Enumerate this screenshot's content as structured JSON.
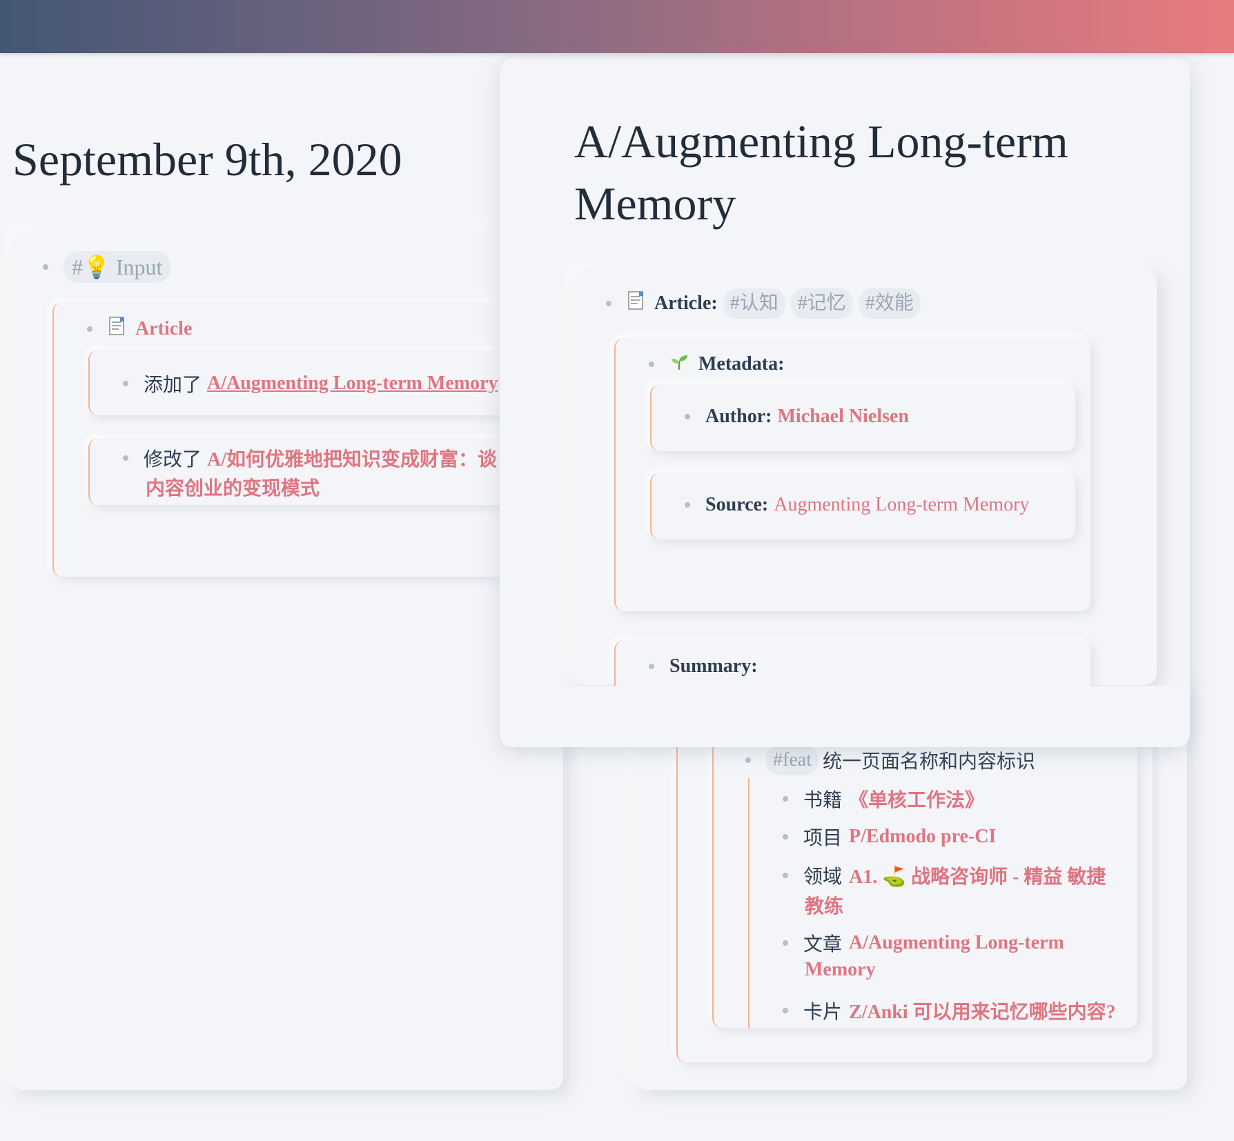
{
  "left": {
    "date_title": "September 9th, 2020",
    "input_tag": "#💡 Input",
    "article_label": "Article",
    "added_prefix": "添加了",
    "added_link": "A/Augmenting Long-term Memory",
    "modified_prefix": "修改了",
    "modified_link_line1": "A/如何优雅地把知识变成财富：谈",
    "modified_link_line2": "内容创业的变现模式"
  },
  "right": {
    "page_title_line1": "A/Augmenting Long-term",
    "page_title_line2": "Memory",
    "article_label": "Article:",
    "tags": [
      "#认知",
      "#记忆",
      "#效能"
    ],
    "metadata_label": "Metadata:",
    "author_label": "Author:",
    "author_value": "Michael Nielsen",
    "source_label": "Source:",
    "source_value": "Augmenting Long-term Memory",
    "summary_label": "Summary:"
  },
  "background_card": {
    "feat_tag": "#feat",
    "feat_text": "统一页面名称和内容标识",
    "items": [
      {
        "prefix": "书籍",
        "link": "《单核工作法》"
      },
      {
        "prefix": "项目",
        "link": "P/Edmodo pre-CI"
      },
      {
        "prefix": "领域",
        "link_line1": "A1. ⛳ 战略咨询师 - 精益 敏捷",
        "link_line2": "教练"
      },
      {
        "prefix": "文章",
        "link_line1": "A/Augmenting Long-term",
        "link_line2": "Memory"
      },
      {
        "prefix": "卡片",
        "link": "Z/Anki 可以用来记忆哪些内容?"
      }
    ]
  },
  "colors": {
    "accent": "#e07480",
    "text": "#2d3d52",
    "tag_bg": "#e8ebf0",
    "border_accent": "#f0b596",
    "gradient_start": "#435775",
    "gradient_end": "#e87b80"
  }
}
